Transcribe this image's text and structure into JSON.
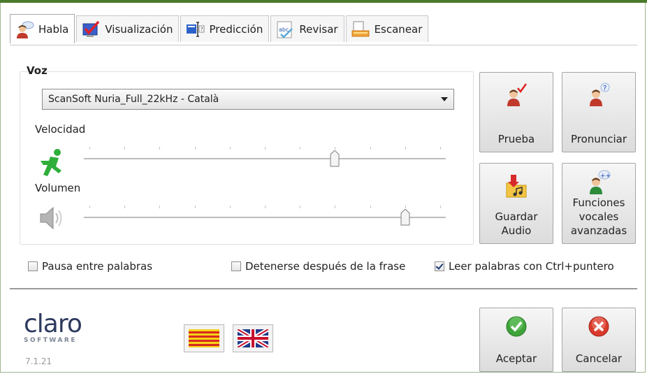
{
  "tabs": [
    {
      "label": "Habla",
      "icon": "speaking-person-icon",
      "active": true
    },
    {
      "label": "Visualización",
      "icon": "checkmark-monitor-icon",
      "active": false
    },
    {
      "label": "Predicción",
      "icon": "text-cursor-icon",
      "active": false
    },
    {
      "label": "Revisar",
      "icon": "spellcheck-abc-icon",
      "active": false
    },
    {
      "label": "Escanear",
      "icon": "scanner-icon",
      "active": false
    }
  ],
  "voz": {
    "group_label": "Voz",
    "selected_voice": "ScanSoft Nuria_Full_22kHz - Català",
    "velocidad_label": "Velocidad",
    "velocidad_value": 0.7,
    "volumen_label": "Volumen",
    "volumen_value": 0.9
  },
  "buttons": {
    "prueba": "Prueba",
    "pronunciar": "Pronunciar",
    "guardar_line1": "Guardar",
    "guardar_line2": "Audio",
    "funciones_line1": "Funciones",
    "funciones_line2": "vocales",
    "funciones_line3": "avanzadas",
    "aceptar": "Aceptar",
    "cancelar": "Cancelar"
  },
  "options": [
    {
      "label": "Pausa entre palabras",
      "checked": false
    },
    {
      "label": "Detenerse después de la frase",
      "checked": false
    },
    {
      "label": "Leer palabras con Ctrl+puntero",
      "checked": true
    }
  ],
  "footer": {
    "logo_text": "claro",
    "logo_sub": "SOFTWARE",
    "version": "7.1.21",
    "flags": [
      "catalan-flag-icon",
      "uk-flag-icon"
    ]
  },
  "colors": {
    "accent_green": "#4b7a2a",
    "ok_green": "#3ea33a",
    "cancel_red": "#d83a2c"
  }
}
